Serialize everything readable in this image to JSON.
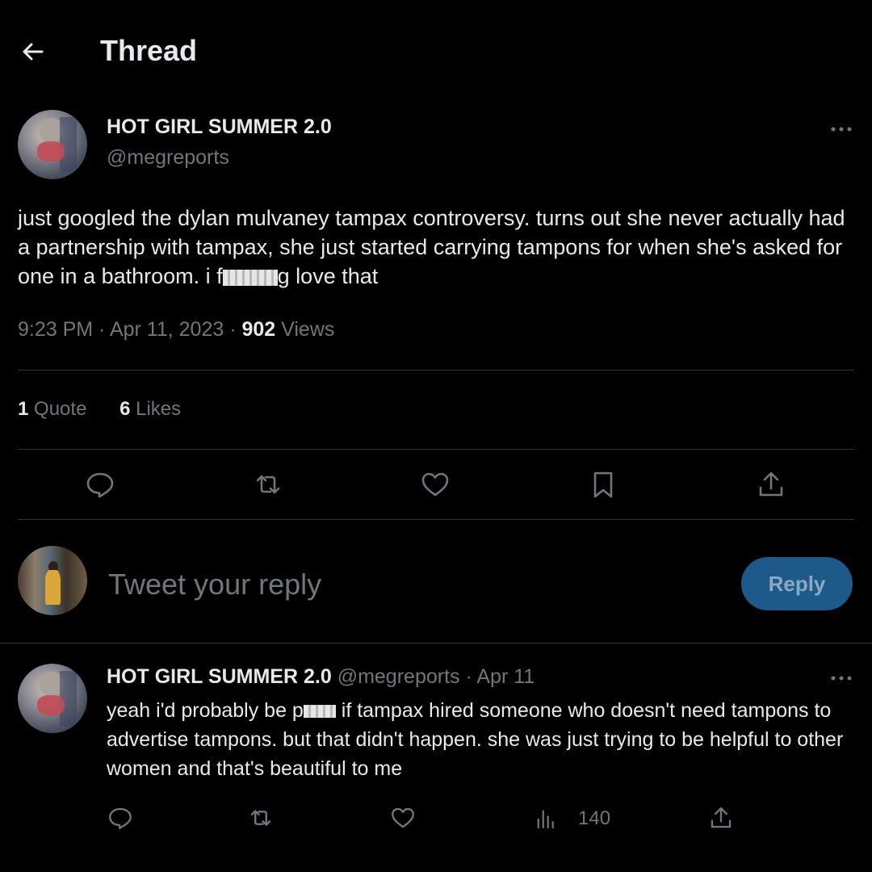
{
  "header": {
    "title": "Thread"
  },
  "tweet": {
    "author_name": "HOT GIRL SUMMER 2.0",
    "author_handle": "@megreports",
    "text_before": "just googled the dylan mulvaney tampax controversy. turns out she never actually had a partnership with tampax, she just started carrying tampons for when she's asked for one in a bathroom. i f",
    "text_after": "g love that",
    "time": "9:23 PM",
    "date": "Apr 11, 2023",
    "views_count": "902",
    "views_label": "Views",
    "quotes_count": "1",
    "quotes_label": "Quote",
    "likes_count": "6",
    "likes_label": "Likes"
  },
  "reply_box": {
    "placeholder": "Tweet your reply",
    "button_label": "Reply"
  },
  "reply": {
    "author_name": "HOT GIRL SUMMER 2.0",
    "author_handle": "@megreports",
    "date": "Apr 11",
    "text_before": "yeah i'd probably be p",
    "text_after": " if tampax hired someone who doesn't need tampons to advertise tampons. but that didn't happen. she was just trying to be helpful to other women and that's beautiful to me",
    "views": "140"
  },
  "colors": {
    "background": "#000000",
    "text": "#e7e9ea",
    "secondary": "#71767b",
    "divider": "#2f3336",
    "reply_button": "#1d5a8a"
  }
}
